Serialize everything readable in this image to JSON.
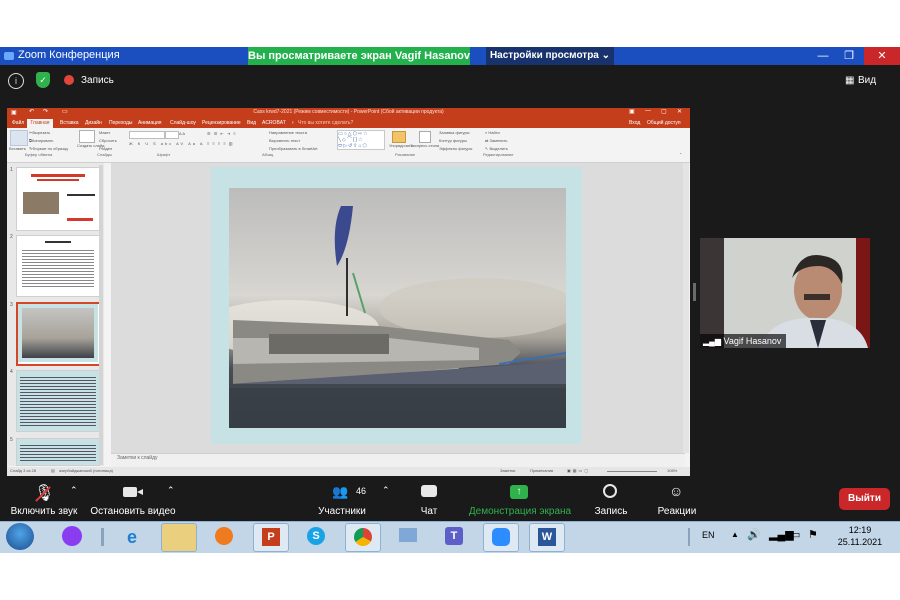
{
  "zoom": {
    "window_title": "Zoom Конференция",
    "share_banner": "Вы просматриваете экран Vagif Hasanov",
    "view_settings": "Настройки просмотра",
    "record_label": "Запись",
    "view_label": "Вид",
    "toolbar": {
      "mute_label": "Включить звук",
      "video_label": "Остановить видео",
      "participants_count": "46",
      "participants_label": "Участники",
      "chat_label": "Чат",
      "share_label": "Демонстрация экрана",
      "record_label": "Запись",
      "reactions_label": "Реакции",
      "exit_label": "Выйти"
    },
    "participant_name": "Vagif Hasanov"
  },
  "ppt": {
    "title": "Cass krwd7-2021 (Режим совместимости) - PowerPoint (Сбой активации продукта)",
    "tabs": [
      "Файл",
      "Главная",
      "Вставка",
      "Дизайн",
      "Переходы",
      "Анимация",
      "Слайд-шоу",
      "Рецензирование",
      "Вид",
      "ACROBAT"
    ],
    "search_hint": "Что вы хотите сделать?",
    "signin": "Вход",
    "share": "Общий доступ",
    "ribbon_groups": [
      "Буфер обмена",
      "Слайды",
      "Шрифт",
      "Абзац",
      "Рисование",
      "Редактирование"
    ],
    "ribbon_items": {
      "paste": "Вставить",
      "cut": "Вырезать",
      "copy": "Копировать",
      "format_painter": "Формат по образцу",
      "new_slide": "Создать слайд",
      "layout": "Макет",
      "reset": "Сбросить",
      "section": "Раздел",
      "arrange": "Упорядочить",
      "quick_styles": "Экспресс-стили",
      "shape_fill": "Заливка фигуры",
      "shape_outline": "Контур фигуры",
      "shape_effects": "Эффекты фигуры",
      "find": "Найти",
      "replace": "Заменить",
      "select": "Выделить",
      "text_direction": "Направление текста",
      "align_text": "Выровнять текст",
      "smartart": "Преобразовать в SmartArt"
    },
    "thumb_numbers": [
      "1",
      "2",
      "3",
      "4",
      "5"
    ],
    "notes_placeholder": "Заметки к слайду",
    "status_left": "Слайд 3 из 28",
    "status_lang": "азербайджанский (латиница)",
    "status_notes": "Заметки",
    "status_comments": "Примечания",
    "zoom_pct": "106%"
  },
  "taskbar": {
    "lang": "EN",
    "time": "12:19",
    "date": "25.11.2021"
  }
}
